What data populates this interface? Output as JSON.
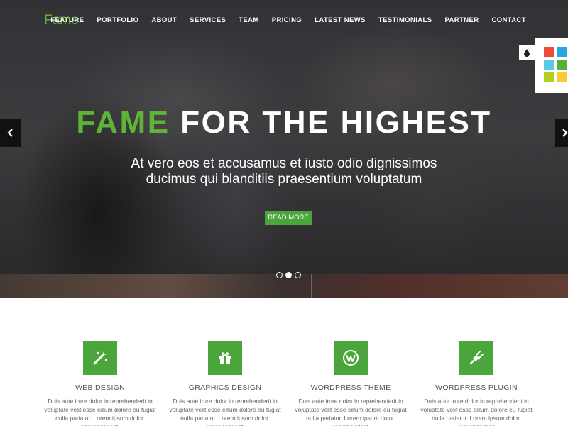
{
  "brand": {
    "logo": "Fame"
  },
  "nav": {
    "items": [
      "FEATURE",
      "PORTFOLIO",
      "ABOUT",
      "SERVICES",
      "TEAM",
      "PRICING",
      "LATEST NEWS",
      "TESTIMONIALS",
      "PARTNER",
      "CONTACT"
    ]
  },
  "hero": {
    "title_accent": "FAME",
    "title_rest": "FOR THE HIGHEST",
    "subtitle_line1": "At vero eos et accusamus et iusto odio dignissimos",
    "subtitle_line2": "ducimus qui blanditiis praesentium voluptatum",
    "button_label": "READ MORE",
    "prev_icon": "chevron-left-icon",
    "next_icon": "chevron-right-icon",
    "slides_total": 3,
    "active_slide": 2
  },
  "style_switcher": {
    "toggle_icon": "droplet-icon",
    "swatches": [
      "#f04b3a",
      "#2aa3e2",
      "#5ac8e8",
      "#55b236",
      "#b3cf1f",
      "#f7cc35"
    ]
  },
  "colors": {
    "accent": "#5fb336",
    "button": "#4aa63a"
  },
  "features": [
    {
      "icon": "magic-wand-icon",
      "title": "WEB DESIGN",
      "text": "Duis aute irure dolor in reprehenderit in voluptate velit esse cillum dolore eu fugiat nulla pariatur. Lorem ipsum dolor. reprehenderit"
    },
    {
      "icon": "gift-icon",
      "title": "GRAPHICS DESIGN",
      "text": "Duis aute irure dolor in reprehenderit in voluptate velit esse cillum dolore eu fugiat nulla pariatur. Lorem ipsum dolor. reprehenderit"
    },
    {
      "icon": "wordpress-icon",
      "title": "WORDPRESS THEME",
      "text": "Duis aute irure dolor in reprehenderit in voluptate velit esse cillum dolore eu fugiat nulla pariatur. Lorem ipsum dolor. reprehenderit"
    },
    {
      "icon": "plug-icon",
      "title": "WORDPRESS PLUGIN",
      "text": "Duis aute irure dolor in reprehenderit in voluptate velit esse cillum dolore eu fugiat nulla pariatur. Lorem ipsum dolor. reprehenderit"
    }
  ]
}
